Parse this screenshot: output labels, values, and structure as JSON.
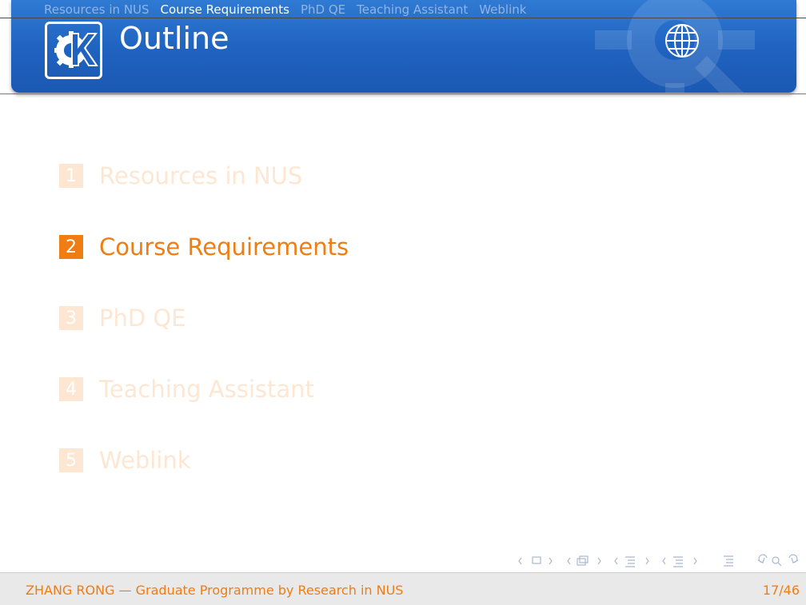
{
  "header": {
    "nav": [
      "Resources in NUS",
      "Course Requirements",
      "PhD QE",
      "Teaching Assistant",
      "Weblink"
    ],
    "active_nav_index": 1,
    "frame_title": "Outline",
    "logo_icon": "kde-logo-icon",
    "right_icon": "globe-icon"
  },
  "outline": {
    "items": [
      {
        "number": "1",
        "label": "Resources in NUS",
        "state": "dimmed"
      },
      {
        "number": "2",
        "label": "Course Requirements",
        "state": "current"
      },
      {
        "number": "3",
        "label": "PhD QE",
        "state": "dimmed"
      },
      {
        "number": "4",
        "label": "Teaching Assistant",
        "state": "dimmed"
      },
      {
        "number": "5",
        "label": "Weblink",
        "state": "dimmed"
      }
    ]
  },
  "footer": {
    "text": "ZHANG RONG — Graduate Programme by Research in NUS",
    "page": "17/46"
  },
  "colors": {
    "accent": "#ee7d14",
    "header_blue": "#1f62bf",
    "dimmed": "#fde7d3"
  }
}
